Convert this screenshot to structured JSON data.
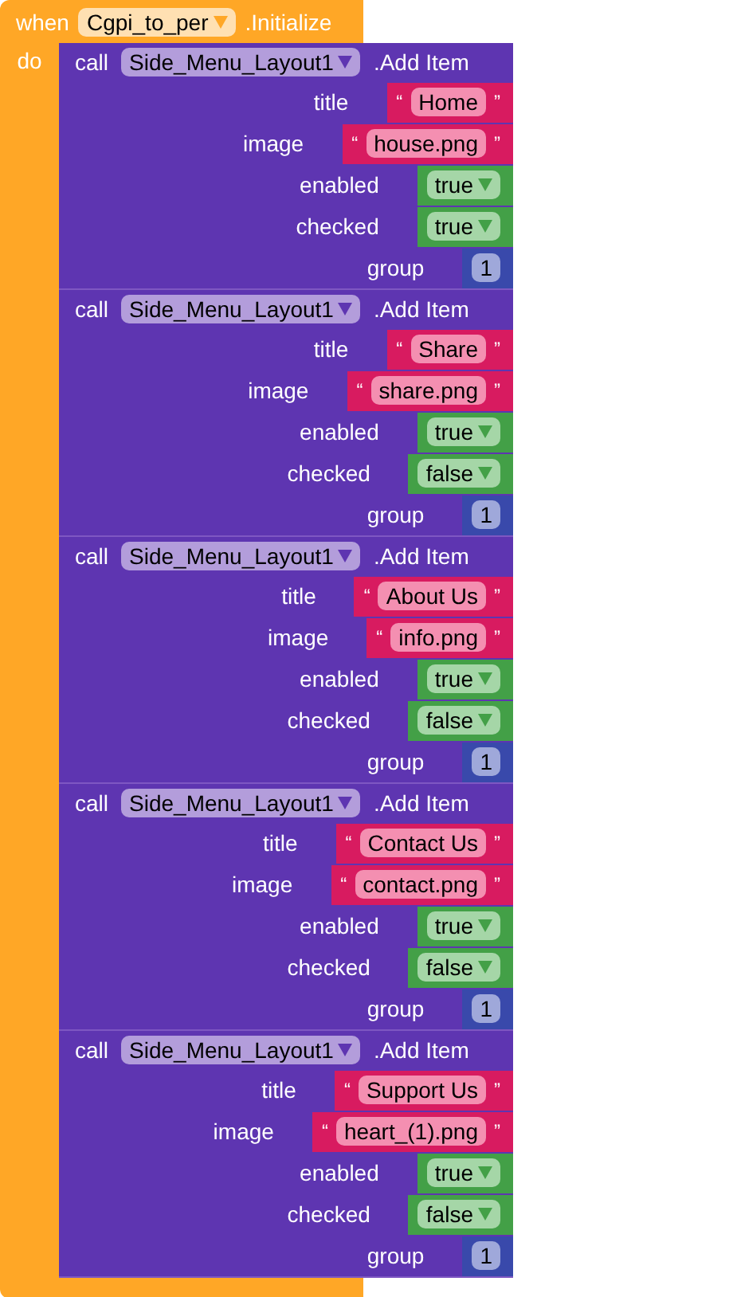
{
  "event": {
    "when": "when",
    "component": "Cgpi_to_per",
    "method": ".Initialize",
    "do": "do"
  },
  "calls": [
    {
      "call": "call",
      "component": "Side_Menu_Layout1",
      "method": ".Add Item",
      "args": [
        {
          "label": "title",
          "kind": "text",
          "open": "“",
          "value": "Home",
          "close": "”"
        },
        {
          "label": "image",
          "kind": "text",
          "open": "“",
          "value": "house.png",
          "close": "”"
        },
        {
          "label": "enabled",
          "kind": "boolean",
          "value": "true"
        },
        {
          "label": "checked",
          "kind": "boolean",
          "value": "true"
        },
        {
          "label": "group",
          "kind": "number",
          "value": "1"
        }
      ]
    },
    {
      "call": "call",
      "component": "Side_Menu_Layout1",
      "method": ".Add Item",
      "args": [
        {
          "label": "title",
          "kind": "text",
          "open": "“",
          "value": "Share",
          "close": "”"
        },
        {
          "label": "image",
          "kind": "text",
          "open": "“",
          "value": "share.png",
          "close": "”"
        },
        {
          "label": "enabled",
          "kind": "boolean",
          "value": "true"
        },
        {
          "label": "checked",
          "kind": "boolean",
          "value": "false"
        },
        {
          "label": "group",
          "kind": "number",
          "value": "1"
        }
      ]
    },
    {
      "call": "call",
      "component": "Side_Menu_Layout1",
      "method": ".Add Item",
      "args": [
        {
          "label": "title",
          "kind": "text",
          "open": "“",
          "value": "About Us",
          "close": "”"
        },
        {
          "label": "image",
          "kind": "text",
          "open": "“",
          "value": "info.png",
          "close": "”"
        },
        {
          "label": "enabled",
          "kind": "boolean",
          "value": "true"
        },
        {
          "label": "checked",
          "kind": "boolean",
          "value": "false"
        },
        {
          "label": "group",
          "kind": "number",
          "value": "1"
        }
      ]
    },
    {
      "call": "call",
      "component": "Side_Menu_Layout1",
      "method": ".Add Item",
      "args": [
        {
          "label": "title",
          "kind": "text",
          "open": "“",
          "value": "Contact Us",
          "close": "”"
        },
        {
          "label": "image",
          "kind": "text",
          "open": "“",
          "value": "contact.png",
          "close": "”"
        },
        {
          "label": "enabled",
          "kind": "boolean",
          "value": "true"
        },
        {
          "label": "checked",
          "kind": "boolean",
          "value": "false"
        },
        {
          "label": "group",
          "kind": "number",
          "value": "1"
        }
      ]
    },
    {
      "call": "call",
      "component": "Side_Menu_Layout1",
      "method": ".Add Item",
      "args": [
        {
          "label": "title",
          "kind": "text",
          "open": "“",
          "value": "Support Us",
          "close": "”"
        },
        {
          "label": "image",
          "kind": "text",
          "open": "“",
          "value": "heart_(1).png",
          "close": "”"
        },
        {
          "label": "enabled",
          "kind": "boolean",
          "value": "true"
        },
        {
          "label": "checked",
          "kind": "boolean",
          "value": "false"
        },
        {
          "label": "group",
          "kind": "number",
          "value": "1"
        }
      ]
    }
  ]
}
